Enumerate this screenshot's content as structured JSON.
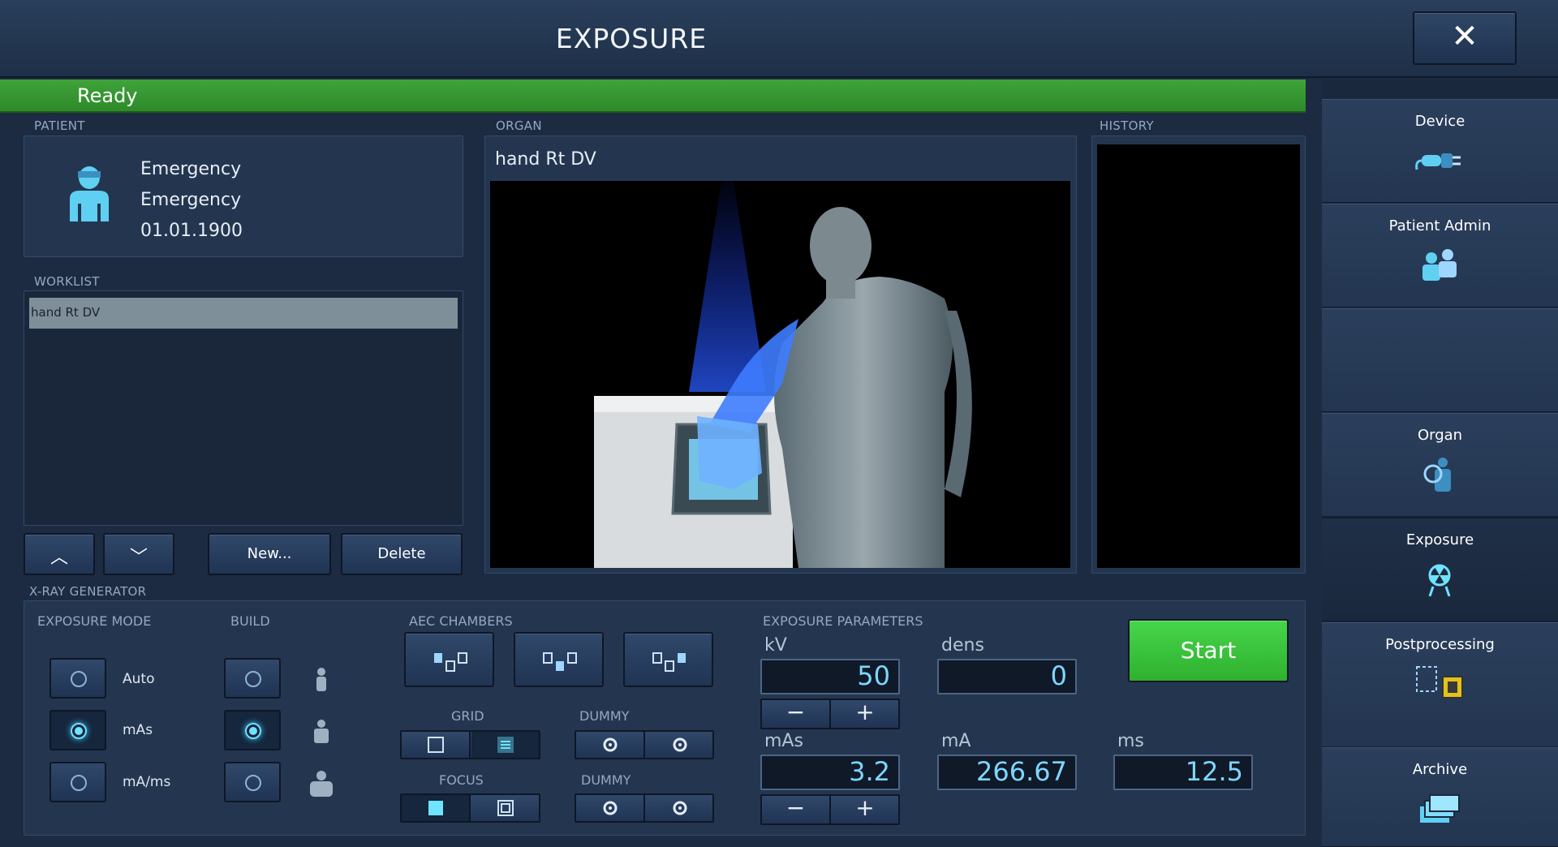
{
  "title": "EXPOSURE",
  "status": "Ready",
  "patient": {
    "section": "PATIENT",
    "name_last": "Emergency",
    "name_first": "Emergency",
    "dob": "01.01.1900"
  },
  "worklist": {
    "section": "WORKLIST",
    "items": [
      "hand Rt DV"
    ],
    "new_label": "New...",
    "delete_label": "Delete"
  },
  "organ": {
    "section": "ORGAN",
    "name": "hand Rt DV"
  },
  "history": {
    "section": "HISTORY"
  },
  "generator": {
    "section": "X-RAY GENERATOR",
    "exposure_mode": {
      "label": "EXPOSURE MODE",
      "options": [
        "Auto",
        "mAs",
        "mA/ms"
      ],
      "selected": "mAs"
    },
    "build": {
      "label": "BUILD",
      "selected_index": 1
    },
    "aec": {
      "label": "AEC CHAMBERS"
    },
    "grid_label": "GRID",
    "focus_label": "FOCUS",
    "dummy1_label": "DUMMY",
    "dummy2_label": "DUMMY",
    "params": {
      "label": "EXPOSURE PARAMETERS",
      "kv_label": "kV",
      "kv": "50",
      "dens_label": "dens",
      "dens": "0",
      "mas_label": "mAs",
      "mas": "3.2",
      "ma_label": "mA",
      "ma": "266.67",
      "ms_label": "ms",
      "ms": "12.5"
    },
    "start_label": "Start"
  },
  "sidebar": {
    "items": [
      {
        "label": "Device",
        "icon": "device-plug-icon"
      },
      {
        "label": "Patient Admin",
        "icon": "patient-admin-icon"
      },
      {
        "label": "",
        "icon": ""
      },
      {
        "label": "Organ",
        "icon": "organ-icon"
      },
      {
        "label": "Exposure",
        "icon": "radiation-icon",
        "active": true
      },
      {
        "label": "Postprocessing",
        "icon": "postprocessing-icon"
      },
      {
        "label": "Archive",
        "icon": "archive-icon"
      }
    ]
  },
  "colors": {
    "status_green": "#3fa33a",
    "start_green": "#33c233",
    "accent_cyan": "#6fe3ff"
  }
}
